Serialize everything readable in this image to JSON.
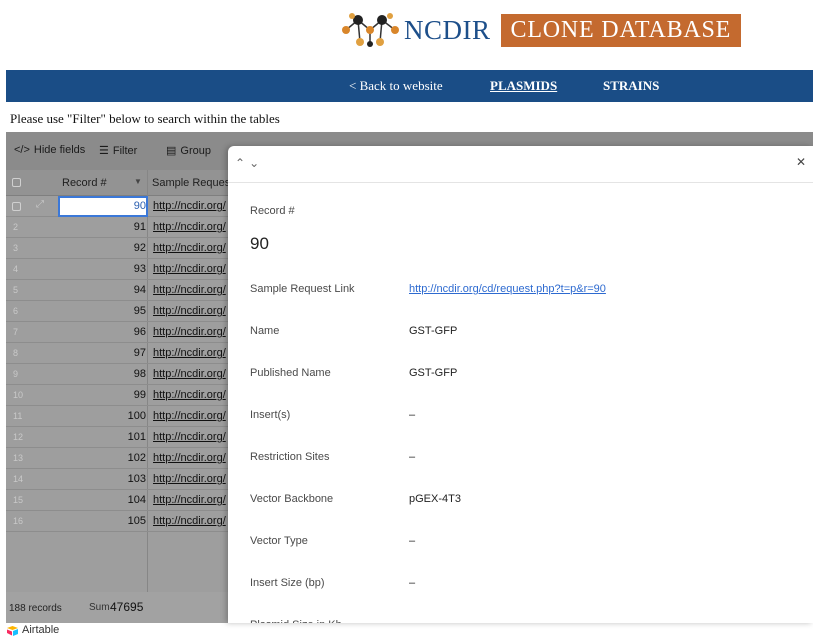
{
  "header": {
    "logo_text": "NCDIR",
    "banner_text": "CLONE DATABASE"
  },
  "nav": {
    "back": "< Back to website",
    "plasmids": "PLASMIDS",
    "strains": "STRAINS"
  },
  "instructions": "Please use \"Filter\" below to search within the tables",
  "toolbar": {
    "hide_fields": "Hide fields",
    "filter": "Filter",
    "group": "Group"
  },
  "grid": {
    "col_record": "Record #",
    "col_sample": "Sample Reques",
    "rows": [
      {
        "num": "",
        "record": "90",
        "link": "http://ncdir.org/"
      },
      {
        "num": "2",
        "record": "91",
        "link": "http://ncdir.org/"
      },
      {
        "num": "3",
        "record": "92",
        "link": "http://ncdir.org/"
      },
      {
        "num": "4",
        "record": "93",
        "link": "http://ncdir.org/"
      },
      {
        "num": "5",
        "record": "94",
        "link": "http://ncdir.org/"
      },
      {
        "num": "6",
        "record": "95",
        "link": "http://ncdir.org/"
      },
      {
        "num": "7",
        "record": "96",
        "link": "http://ncdir.org/"
      },
      {
        "num": "8",
        "record": "97",
        "link": "http://ncdir.org/"
      },
      {
        "num": "9",
        "record": "98",
        "link": "http://ncdir.org/"
      },
      {
        "num": "10",
        "record": "99",
        "link": "http://ncdir.org/"
      },
      {
        "num": "11",
        "record": "100",
        "link": "http://ncdir.org/"
      },
      {
        "num": "12",
        "record": "101",
        "link": "http://ncdir.org/"
      },
      {
        "num": "13",
        "record": "102",
        "link": "http://ncdir.org/"
      },
      {
        "num": "14",
        "record": "103",
        "link": "http://ncdir.org/"
      },
      {
        "num": "15",
        "record": "104",
        "link": "http://ncdir.org/"
      },
      {
        "num": "16",
        "record": "105",
        "link": "http://ncdir.org/"
      }
    ],
    "footer_records": "188 records",
    "footer_sum_label": "Sum",
    "footer_sum": "47695"
  },
  "panel": {
    "record_label": "Record #",
    "record_value": "90",
    "fields": [
      {
        "label": "Sample Request Link",
        "value": "http://ncdir.org/cd/request.php?t=p&r=90",
        "link": true
      },
      {
        "label": "Name",
        "value": "GST-GFP"
      },
      {
        "label": "Published Name",
        "value": "GST-GFP"
      },
      {
        "label": "Insert(s)",
        "value": "–"
      },
      {
        "label": "Restriction Sites",
        "value": "–"
      },
      {
        "label": "Vector Backbone",
        "value": "pGEX-4T3"
      },
      {
        "label": "Vector Type",
        "value": "–"
      },
      {
        "label": "Insert Size (bp)",
        "value": "–"
      },
      {
        "label": "Plasmid Size in Kb",
        "value": ""
      }
    ]
  },
  "footer": {
    "airtable": "Airtable"
  },
  "colors": {
    "nav_blue": "#1a4d86",
    "banner_orange": "#c46a2f",
    "link_blue": "#2d6ad0"
  }
}
